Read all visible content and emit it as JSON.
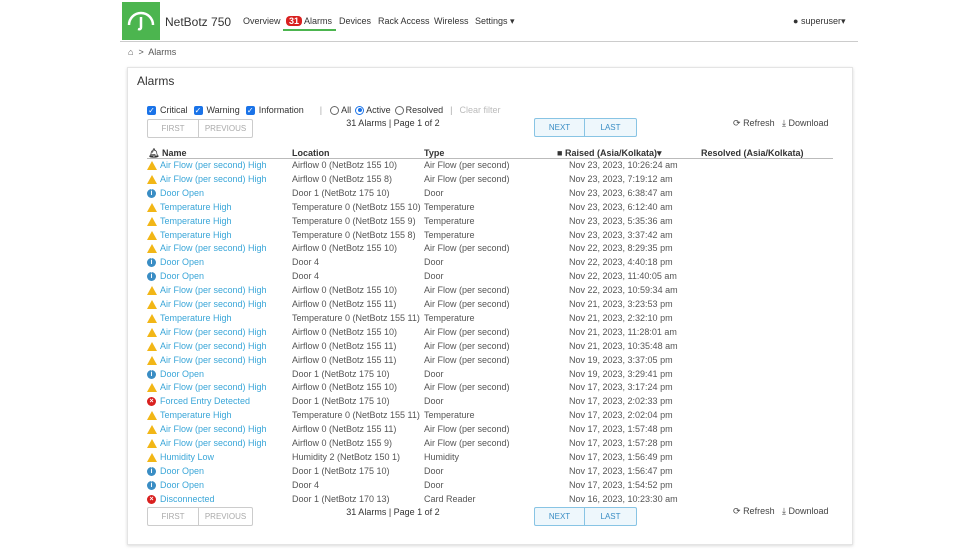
{
  "header": {
    "brand": "NetBotz 750",
    "nav": [
      {
        "label": "Overview"
      },
      {
        "label": "Alarms",
        "badge": "31"
      },
      {
        "label": "Devices"
      },
      {
        "label": "Rack Access"
      },
      {
        "label": "Wireless"
      },
      {
        "label": "Settings"
      }
    ],
    "user": "superuser"
  },
  "breadcrumb": {
    "current": "Alarms"
  },
  "page": {
    "title": "Alarms"
  },
  "filters": {
    "critical": "Critical",
    "warning": "Warning",
    "information": "Information",
    "all": "All",
    "active": "Active",
    "resolved": "Resolved",
    "clear": "Clear filter",
    "selected_state": "Active"
  },
  "pagination": {
    "first": "FIRST",
    "previous": "PREVIOUS",
    "next": "NEXT",
    "last": "LAST",
    "info": "31 Alarms | Page 1 of 2"
  },
  "actions": {
    "refresh": "Refresh",
    "download": "Download"
  },
  "table": {
    "headers": {
      "name": "Name",
      "location": "Location",
      "type": "Type",
      "raised": "Raised (Asia/Kolkata)",
      "resolved": "Resolved (Asia/Kolkata)"
    },
    "rows": [
      {
        "severity": "warning",
        "name": "Air Flow (per second) High",
        "location": "Airflow 0 (NetBotz 155 10)",
        "type": "Air Flow (per second)",
        "raised": "Nov 23, 2023, 10:26:24 am"
      },
      {
        "severity": "warning",
        "name": "Air Flow (per second) High",
        "location": "Airflow 0 (NetBotz 155 8)",
        "type": "Air Flow (per second)",
        "raised": "Nov 23, 2023, 7:19:12 am"
      },
      {
        "severity": "info",
        "name": "Door Open",
        "location": "Door 1 (NetBotz 175 10)",
        "type": "Door",
        "raised": "Nov 23, 2023, 6:38:47 am"
      },
      {
        "severity": "warning",
        "name": "Temperature High",
        "location": "Temperature 0 (NetBotz 155 10)",
        "type": "Temperature",
        "raised": "Nov 23, 2023, 6:12:40 am"
      },
      {
        "severity": "warning",
        "name": "Temperature High",
        "location": "Temperature 0 (NetBotz 155 9)",
        "type": "Temperature",
        "raised": "Nov 23, 2023, 5:35:36 am"
      },
      {
        "severity": "warning",
        "name": "Temperature High",
        "location": "Temperature 0 (NetBotz 155 8)",
        "type": "Temperature",
        "raised": "Nov 23, 2023, 3:37:42 am"
      },
      {
        "severity": "warning",
        "name": "Air Flow (per second) High",
        "location": "Airflow 0 (NetBotz 155 10)",
        "type": "Air Flow (per second)",
        "raised": "Nov 22, 2023, 8:29:35 pm"
      },
      {
        "severity": "info",
        "name": "Door Open",
        "location": "Door 4",
        "type": "Door",
        "raised": "Nov 22, 2023, 4:40:18 pm"
      },
      {
        "severity": "info",
        "name": "Door Open",
        "location": "Door 4",
        "type": "Door",
        "raised": "Nov 22, 2023, 11:40:05 am"
      },
      {
        "severity": "warning",
        "name": "Air Flow (per second) High",
        "location": "Airflow 0 (NetBotz 155 10)",
        "type": "Air Flow (per second)",
        "raised": "Nov 22, 2023, 10:59:34 am"
      },
      {
        "severity": "warning",
        "name": "Air Flow (per second) High",
        "location": "Airflow 0 (NetBotz 155 11)",
        "type": "Air Flow (per second)",
        "raised": "Nov 21, 2023, 3:23:53 pm"
      },
      {
        "severity": "warning",
        "name": "Temperature High",
        "location": "Temperature 0 (NetBotz 155 11)",
        "type": "Temperature",
        "raised": "Nov 21, 2023, 2:32:10 pm"
      },
      {
        "severity": "warning",
        "name": "Air Flow (per second) High",
        "location": "Airflow 0 (NetBotz 155 10)",
        "type": "Air Flow (per second)",
        "raised": "Nov 21, 2023, 11:28:01 am"
      },
      {
        "severity": "warning",
        "name": "Air Flow (per second) High",
        "location": "Airflow 0 (NetBotz 155 11)",
        "type": "Air Flow (per second)",
        "raised": "Nov 21, 2023, 10:35:48 am"
      },
      {
        "severity": "warning",
        "name": "Air Flow (per second) High",
        "location": "Airflow 0 (NetBotz 155 11)",
        "type": "Air Flow (per second)",
        "raised": "Nov 19, 2023, 3:37:05 pm"
      },
      {
        "severity": "info",
        "name": "Door Open",
        "location": "Door 1 (NetBotz 175 10)",
        "type": "Door",
        "raised": "Nov 19, 2023, 3:29:41 pm"
      },
      {
        "severity": "warning",
        "name": "Air Flow (per second) High",
        "location": "Airflow 0 (NetBotz 155 10)",
        "type": "Air Flow (per second)",
        "raised": "Nov 17, 2023, 3:17:24 pm"
      },
      {
        "severity": "critical",
        "name": "Forced Entry Detected",
        "location": "Door 1 (NetBotz 175 10)",
        "type": "Door",
        "raised": "Nov 17, 2023, 2:02:33 pm"
      },
      {
        "severity": "warning",
        "name": "Temperature High",
        "location": "Temperature 0 (NetBotz 155 11)",
        "type": "Temperature",
        "raised": "Nov 17, 2023, 2:02:04 pm"
      },
      {
        "severity": "warning",
        "name": "Air Flow (per second) High",
        "location": "Airflow 0 (NetBotz 155 11)",
        "type": "Air Flow (per second)",
        "raised": "Nov 17, 2023, 1:57:48 pm"
      },
      {
        "severity": "warning",
        "name": "Air Flow (per second) High",
        "location": "Airflow 0 (NetBotz 155 9)",
        "type": "Air Flow (per second)",
        "raised": "Nov 17, 2023, 1:57:28 pm"
      },
      {
        "severity": "warning",
        "name": "Humidity Low",
        "location": "Humidity 2 (NetBotz 150 1)",
        "type": "Humidity",
        "raised": "Nov 17, 2023, 1:56:49 pm"
      },
      {
        "severity": "info",
        "name": "Door Open",
        "location": "Door 1 (NetBotz 175 10)",
        "type": "Door",
        "raised": "Nov 17, 2023, 1:56:47 pm"
      },
      {
        "severity": "info",
        "name": "Door Open",
        "location": "Door 4",
        "type": "Door",
        "raised": "Nov 17, 2023, 1:54:52 pm"
      },
      {
        "severity": "critical",
        "name": "Disconnected",
        "location": "Door 1 (NetBotz 170 13)",
        "type": "Card Reader",
        "raised": "Nov 16, 2023, 10:23:30 am"
      }
    ]
  },
  "colors": {
    "brand": "#4cb54f",
    "link": "#3aa6d8",
    "warning": "#f2b616",
    "info": "#3a8dc4",
    "critical": "#d9201f",
    "badge": "#d9201f"
  }
}
